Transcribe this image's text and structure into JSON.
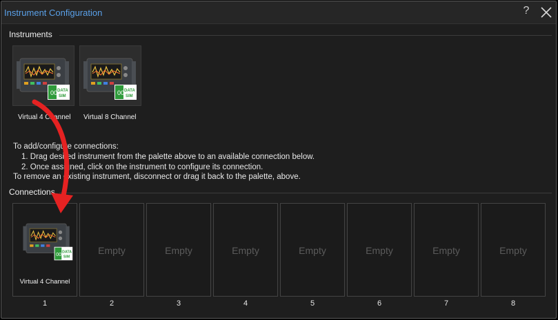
{
  "window": {
    "title": "Instrument Configuration",
    "help_glyph": "?",
    "close_icon": "close-icon"
  },
  "instruments": {
    "heading": "Instruments",
    "items": [
      {
        "label": "Virtual 4 Channel",
        "icon": "instrument-icon",
        "badge": "DATA SIM"
      },
      {
        "label": "Virtual 8 Channel",
        "icon": "instrument-icon",
        "badge": "DATA SIM"
      }
    ]
  },
  "instructions": {
    "line1": "To add/configure connections:",
    "line2": "1. Drag desired instrument from the palette above to an available connection below.",
    "line3": "2. Once assigned, click on the instrument to configure its connection.",
    "line4": "To remove an existing instrument, disconnect or drag it back to the palette, above."
  },
  "connections": {
    "heading": "Connections",
    "slots": [
      {
        "number": "1",
        "label": "Virtual 4 Channel",
        "assigned": true
      },
      {
        "number": "2",
        "label": "Empty",
        "assigned": false
      },
      {
        "number": "3",
        "label": "Empty",
        "assigned": false
      },
      {
        "number": "4",
        "label": "Empty",
        "assigned": false
      },
      {
        "number": "5",
        "label": "Empty",
        "assigned": false
      },
      {
        "number": "6",
        "label": "Empty",
        "assigned": false
      },
      {
        "number": "7",
        "label": "Empty",
        "assigned": false
      },
      {
        "number": "8",
        "label": "Empty",
        "assigned": false
      }
    ]
  },
  "colors": {
    "title": "#5aa0e8",
    "arrow": "#e52222",
    "badge_green": "#2e9a3a"
  }
}
